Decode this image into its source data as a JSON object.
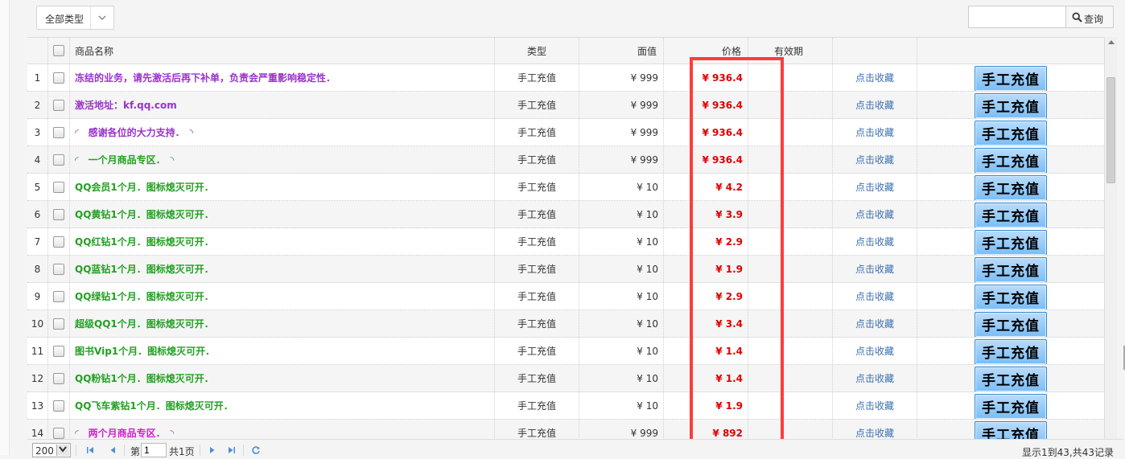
{
  "toolbar": {
    "type_filter": "全部类型",
    "search_placeholder": "",
    "search_label": "查询"
  },
  "table": {
    "headers": {
      "name": "商品名称",
      "type": "类型",
      "face_value": "面值",
      "price": "价格",
      "validity": "有效期"
    },
    "rows": [
      {
        "idx": "1",
        "name": "冻结的业务，请先激活后再下补单，负责会严重影响稳定性．",
        "color": "purple",
        "type": "手工充值",
        "face": "¥ 999",
        "price": "¥ 936.4",
        "validity": "",
        "fav": "点击收藏",
        "action": "手工充值"
      },
      {
        "idx": "2",
        "name": "激活地址：kf.qq.com",
        "color": "purple",
        "type": "手工充值",
        "face": "¥ 999",
        "price": "¥ 936.4",
        "validity": "",
        "fav": "点击收藏",
        "action": "手工充值"
      },
      {
        "idx": "3",
        "name": "◜　感谢各位的大力支持．　◝",
        "color": "purple",
        "type": "手工充值",
        "face": "¥ 999",
        "price": "¥ 936.4",
        "validity": "",
        "fav": "点击收藏",
        "action": "手工充值"
      },
      {
        "idx": "4",
        "name": "◜　一个月商品专区．　◝",
        "color": "green",
        "type": "手工充值",
        "face": "¥ 999",
        "price": "¥ 936.4",
        "validity": "",
        "fav": "点击收藏",
        "action": "手工充值"
      },
      {
        "idx": "5",
        "name": "QQ会员1个月．图标熄灭可开．",
        "color": "green",
        "type": "手工充值",
        "face": "¥ 10",
        "price": "¥ 4.2",
        "validity": "",
        "fav": "点击收藏",
        "action": "手工充值"
      },
      {
        "idx": "6",
        "name": "QQ黄钻1个月．图标熄灭可开．",
        "color": "green",
        "type": "手工充值",
        "face": "¥ 10",
        "price": "¥ 3.9",
        "validity": "",
        "fav": "点击收藏",
        "action": "手工充值"
      },
      {
        "idx": "7",
        "name": "QQ红钻1个月．图标熄灭可开．",
        "color": "green",
        "type": "手工充值",
        "face": "¥ 10",
        "price": "¥ 2.9",
        "validity": "",
        "fav": "点击收藏",
        "action": "手工充值"
      },
      {
        "idx": "8",
        "name": "QQ蓝钻1个月．图标熄灭可开．",
        "color": "green",
        "type": "手工充值",
        "face": "¥ 10",
        "price": "¥ 1.9",
        "validity": "",
        "fav": "点击收藏",
        "action": "手工充值"
      },
      {
        "idx": "9",
        "name": "QQ绿钻1个月．图标熄灭可开．",
        "color": "green",
        "type": "手工充值",
        "face": "¥ 10",
        "price": "¥ 2.9",
        "validity": "",
        "fav": "点击收藏",
        "action": "手工充值"
      },
      {
        "idx": "10",
        "name": "超级QQ1个月．图标熄灭可开．",
        "color": "green",
        "type": "手工充值",
        "face": "¥ 10",
        "price": "¥ 3.4",
        "validity": "",
        "fav": "点击收藏",
        "action": "手工充值"
      },
      {
        "idx": "11",
        "name": "图书Vip1个月．图标熄灭可开．",
        "color": "green",
        "type": "手工充值",
        "face": "¥ 10",
        "price": "¥ 1.4",
        "validity": "",
        "fav": "点击收藏",
        "action": "手工充值"
      },
      {
        "idx": "12",
        "name": "QQ粉钻1个月．图标熄灭可开．",
        "color": "green",
        "type": "手工充值",
        "face": "¥ 10",
        "price": "¥ 1.4",
        "validity": "",
        "fav": "点击收藏",
        "action": "手工充值"
      },
      {
        "idx": "13",
        "name": "QQ飞车紫钻1个月．图标熄灭可开．",
        "color": "green",
        "type": "手工充值",
        "face": "¥ 10",
        "price": "¥ 1.9",
        "validity": "",
        "fav": "点击收藏",
        "action": "手工充值"
      },
      {
        "idx": "14",
        "name": "◜　两个月商品专区．　◝",
        "color": "magenta",
        "type": "手工充值",
        "face": "¥ 999",
        "price": "¥ 892",
        "validity": "",
        "fav": "点击收藏",
        "action": "手工充值"
      }
    ]
  },
  "pager": {
    "page_size": "200",
    "page_prefix": "第",
    "current_page": "1",
    "total_pages": "共1页",
    "summary": "显示1到43,共43记录"
  },
  "colors": {
    "price": "#e00000",
    "highlight": "#ff3c3c",
    "button": "#79bdf6",
    "link": "#3a6fb0"
  }
}
